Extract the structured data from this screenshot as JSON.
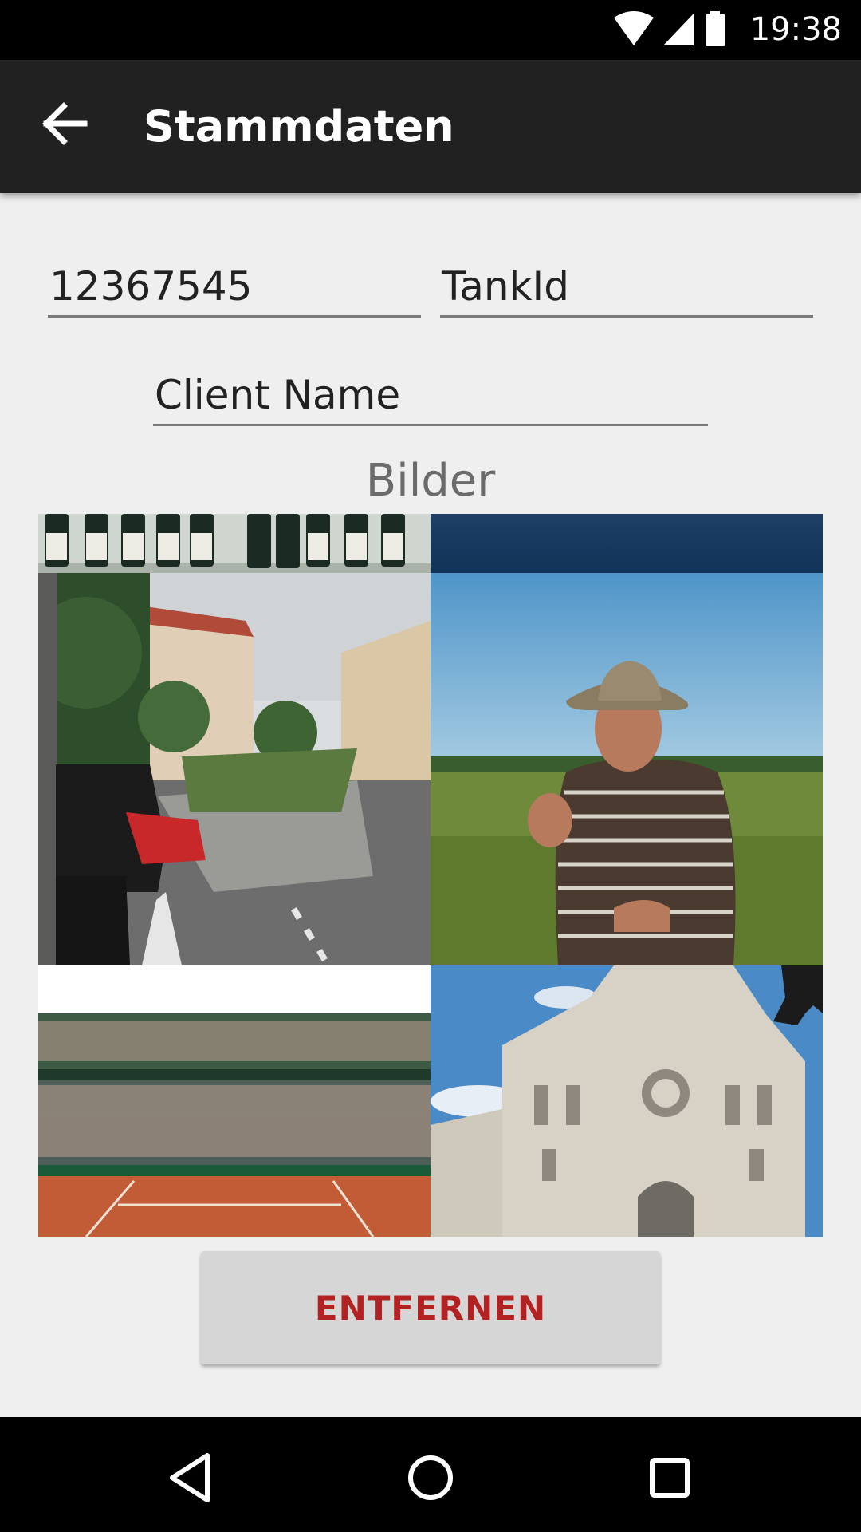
{
  "statusbar": {
    "time": "19:38",
    "icons": [
      "wifi-icon",
      "signal-icon",
      "battery-icon"
    ]
  },
  "toolbar": {
    "title": "Stammdaten",
    "back_icon": "arrow-back-icon"
  },
  "form": {
    "id_value": "12367545",
    "tank_value": "TankId",
    "client_value": "Client Name"
  },
  "gallery": {
    "label": "Bilder",
    "photos": [
      {
        "subject": "wine bottles"
      },
      {
        "subject": "blue sky"
      },
      {
        "subject": "city street with cars"
      },
      {
        "subject": "man with cowboy hat in field"
      },
      {
        "subject": "tennis stadium"
      },
      {
        "subject": "cathedral"
      }
    ]
  },
  "actions": {
    "remove_label": "ENTFERNEN"
  },
  "navbar": {
    "icons": [
      "back-triangle-icon",
      "home-circle-icon",
      "recents-square-icon"
    ]
  },
  "colors": {
    "toolbar": "#212121",
    "accent": "#b22222",
    "background": "#efefef"
  }
}
